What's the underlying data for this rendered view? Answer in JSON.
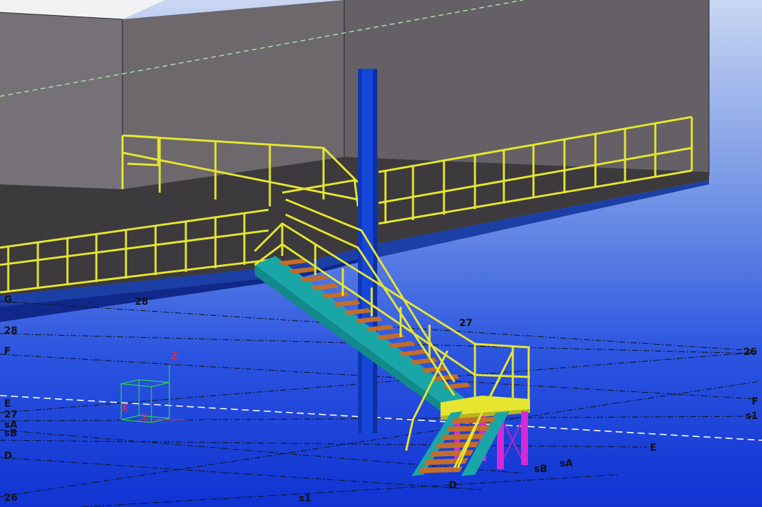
{
  "scene": {
    "grid_labels": {
      "left_g": "G",
      "left_28": "28",
      "top_28": "28",
      "left_f": "F",
      "left_e": "E",
      "left_27": "27",
      "left_sa": "sA",
      "left_sb": "sB",
      "left_d": "D",
      "left_26": "26",
      "top_27": "27",
      "right_26": "26",
      "right_f": "F",
      "right_s1": "s1",
      "right_e": "E",
      "bottom_sa": "sA",
      "bottom_sb": "sB",
      "bottom_d": "D",
      "bottom_s1": "s1"
    },
    "axis": {
      "z": "Z",
      "x": "X",
      "y": "Y"
    }
  },
  "colors": {
    "sky_top": "#c4d2f2",
    "sky_bottom": "#1238d8",
    "wall": "#6f6b6f",
    "floor": "#3a3a3a",
    "slab_edge": "#1d3a93",
    "column": "#1448d8",
    "railing": "#e7e532",
    "stringer": "#1aa6a6",
    "tread": "#c06a2a",
    "support": "#d62ad6"
  }
}
